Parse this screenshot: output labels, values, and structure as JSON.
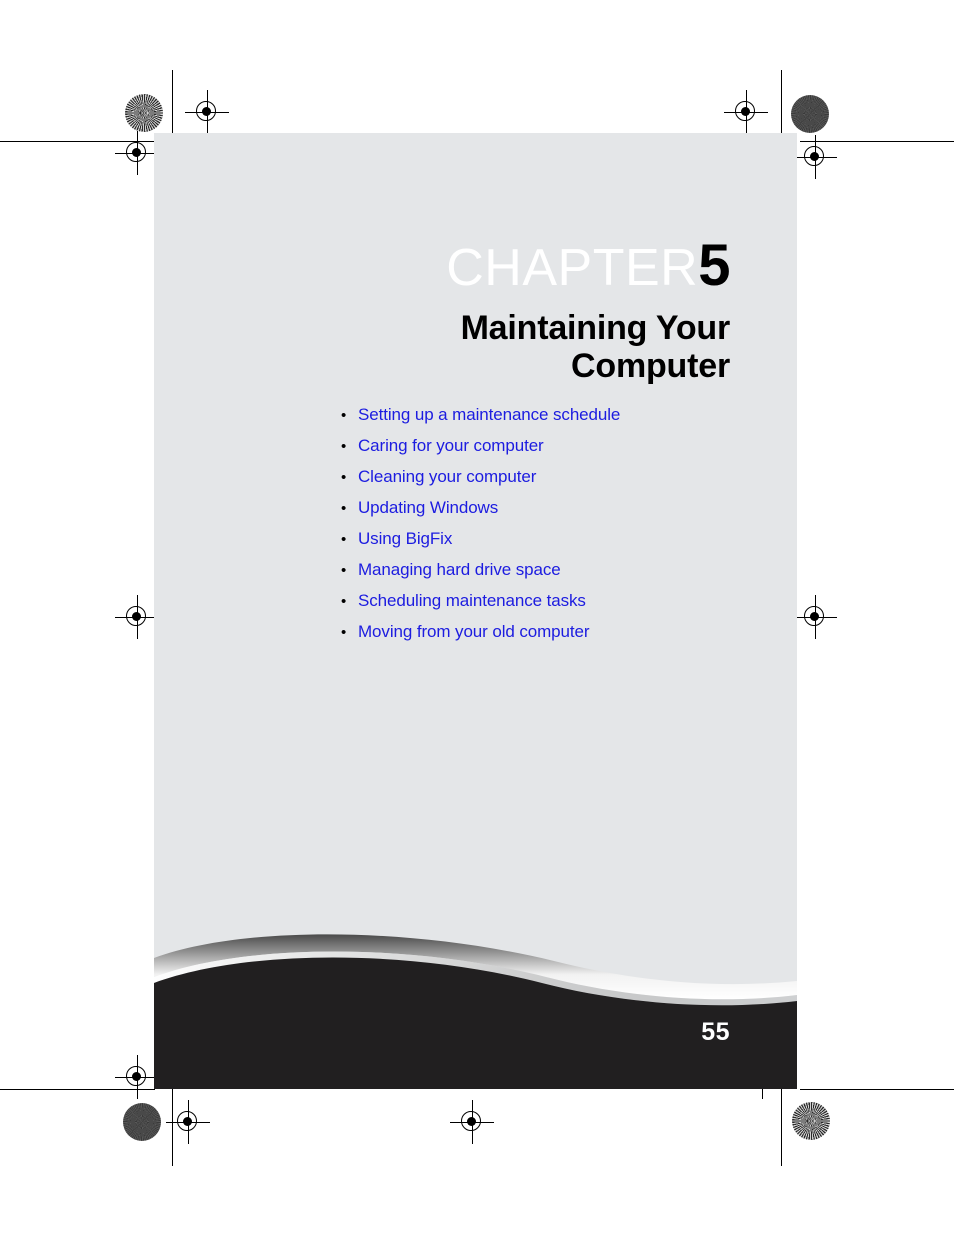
{
  "document": {
    "type": "printed-manual-chapter-opener",
    "chapter_label": "CHAPTER",
    "chapter_number": "5",
    "title_line_1": "Maintaining Your",
    "title_line_2": "Computer",
    "page_number": "55"
  },
  "topics": [
    {
      "bullet": "•",
      "label": "Setting up a maintenance schedule"
    },
    {
      "bullet": "•",
      "label": "Caring for your computer"
    },
    {
      "bullet": "•",
      "label": "Cleaning your computer"
    },
    {
      "bullet": "•",
      "label": "Updating Windows"
    },
    {
      "bullet": "•",
      "label": "Using BigFix"
    },
    {
      "bullet": "•",
      "label": "Managing hard drive space"
    },
    {
      "bullet": "•",
      "label": "Scheduling maintenance tasks"
    },
    {
      "bullet": "•",
      "label": "Moving from your old computer"
    }
  ],
  "colors": {
    "sheet": "#ffffff",
    "panel": "#e4e6e8",
    "link": "#1c1ce0",
    "footer": "#211f20",
    "chapter_word": "#ffffff",
    "chapter_number": "#000000",
    "title": "#000000",
    "page_number": "#ffffff",
    "marks": "#000000"
  },
  "prepress": {
    "registration_targets": 8,
    "rosette_targets": 4,
    "crop_marks": true
  }
}
